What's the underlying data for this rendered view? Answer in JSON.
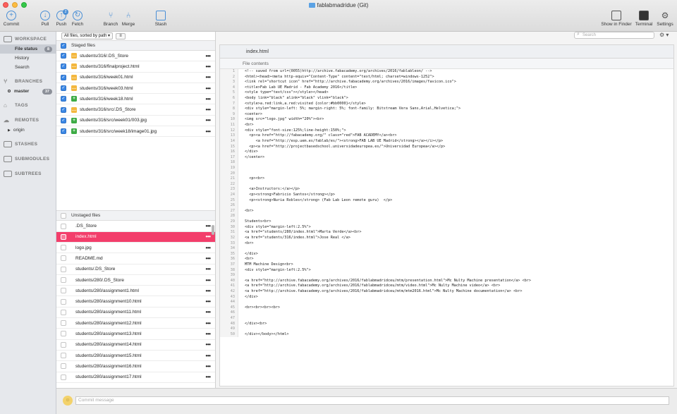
{
  "window": {
    "title": "fablabmadridue (Git)"
  },
  "toolbar": {
    "commit": "Commit",
    "pull": "Pull",
    "push": "Push",
    "push_badge": "2",
    "fetch": "Fetch",
    "branch": "Branch",
    "merge": "Merge",
    "stash": "Stash",
    "show_in_finder": "Show in Finder",
    "terminal": "Terminal",
    "settings": "Settings"
  },
  "sidebar": {
    "workspace": "WORKSPACE",
    "file_status": "File status",
    "file_status_count": "8",
    "history": "History",
    "search": "Search",
    "branches": "BRANCHES",
    "master": "master",
    "master_count": "37",
    "tags": "TAGS",
    "remotes": "REMOTES",
    "origin": "origin",
    "stashes": "STASHES",
    "submodules": "SUBMODULES",
    "subtrees": "SUBTREES"
  },
  "filter": {
    "label": "All files, sorted by path",
    "list_icon": "≡"
  },
  "staged": {
    "header": "Staged files",
    "files": [
      {
        "name": "students/316/.DS_Store",
        "status": "mod"
      },
      {
        "name": "students/316/finalproject.html",
        "status": "mod"
      },
      {
        "name": "students/316/week01.html",
        "status": "mod"
      },
      {
        "name": "students/316/week03.html",
        "status": "mod"
      },
      {
        "name": "students/316/week18.html",
        "status": "add"
      },
      {
        "name": "students/316/src/.DS_Store",
        "status": "mod"
      },
      {
        "name": "students/316/src/week01/003.jpg",
        "status": "add"
      },
      {
        "name": "students/316/src/week18/image01.jpg",
        "status": "add"
      }
    ]
  },
  "unstaged": {
    "header": "Unstaged files",
    "files": [
      {
        "name": ".DS_Store"
      },
      {
        "name": "index.html",
        "selected": true
      },
      {
        "name": "logo.jpg"
      },
      {
        "name": "README.md"
      },
      {
        "name": "students/.DS_Store"
      },
      {
        "name": "students/280/.DS_Store"
      },
      {
        "name": "students/280/assignment1.html"
      },
      {
        "name": "students/280/assignment10.html"
      },
      {
        "name": "students/280/assignment11.html"
      },
      {
        "name": "students/280/assignment12.html"
      },
      {
        "name": "students/280/assignment13.html"
      },
      {
        "name": "students/280/assignment14.html"
      },
      {
        "name": "students/280/assignment15.html"
      },
      {
        "name": "students/280/assignment16.html"
      },
      {
        "name": "students/280/assignment17.html"
      }
    ]
  },
  "search_placeholder": "Search",
  "diff": {
    "filename": "index.html",
    "section": "File contents",
    "lines": [
      "<!-- saved from url=(0055)http://archive.fabacademy.org/archives/2016/fablableon/ -->",
      "<html><head><meta http-equiv=\"Content-Type\" content=\"text/html; charset=windows-1252\">",
      "<link rel=\"shortcut icon\" href=\"http://archive.fabacademy.org/archives/2016/images/favicon.ico\">",
      "<title>Fab Lab UE Madrid - Fab Academy 2016</title>",
      "<style type=\"text/css\"></style></head>",
      "<body link=\"black\" alink=\"black\" vlink=\"black\">",
      "<style>a.red:link,a.red:visited {color:#bb0000}</style>",
      "<div style=\"margin-left: 5%; margin-right: 5%; font-family: Bitstream Vera Sans,Arial,Helvetica;\">",
      "<center>",
      "<img src=\"logo.jpg\" width=\"20%\"><br>",
      "<br>",
      "<div style=\"font-size:125%;line-height:150%;\">",
      "  <p><a href=\"http://fabacademy.org/\" class=\"red\">FAB ACADEMY</a><br>",
      "     <a href=\"http://esp.uem.es/fablab/es/\"><strong>FAB LAB UE Madrid</strong></a></i></p>",
      "  <p><a href=\"http://projectbasedschool.universidadeuropea.es/\">Universidad Europea</a></p>",
      "</div>",
      "</center>",
      "",
      "",
      "",
      "  <p><br>",
      "",
      "  <a>Instructors:</a></p>",
      "  <p><strong>Fabricio Santos</strong></p>",
      "  <p><strong>Nuria Robles</strong> (Fab Lab Leon remote guru)  </p>",
      "",
      "<br>",
      "",
      "Students<br>",
      "<div style=\"margin-left:2.5%\">",
      "<a href=\"students/280/index.html\">Marta Verde</a><br>",
      "<a href=\"students/316/index.html\">Jose Real </a>",
      "<br>",
      "",
      "</div>",
      "<br>",
      "MTM Machine Design<br>",
      "<div style=\"margin-left:2.5%\">",
      "",
      "<a href=\"http://archive.fabacademy.org/archives/2016/fablabmadridceu/mtm/presentation.html\">Mc Nulty Machine presentation</a> <br>",
      "<a href=\"http://archive.fabacademy.org/archives/2016/fablabmadridceu/mtm/video.html\">Mc Nulty Machine video</a> <br>",
      "<a href=\"http://archive.fabacademy.org/archives/2016/fablabmadridceu/mtm/mtm2016.html\">Mc Nulty Machine documentation</a> <br>",
      "</div>",
      "",
      "<br><br><br><br>",
      "",
      "",
      "</div><br>",
      "",
      "</div></body></html>"
    ]
  },
  "commit": {
    "placeholder": "Commit message"
  }
}
